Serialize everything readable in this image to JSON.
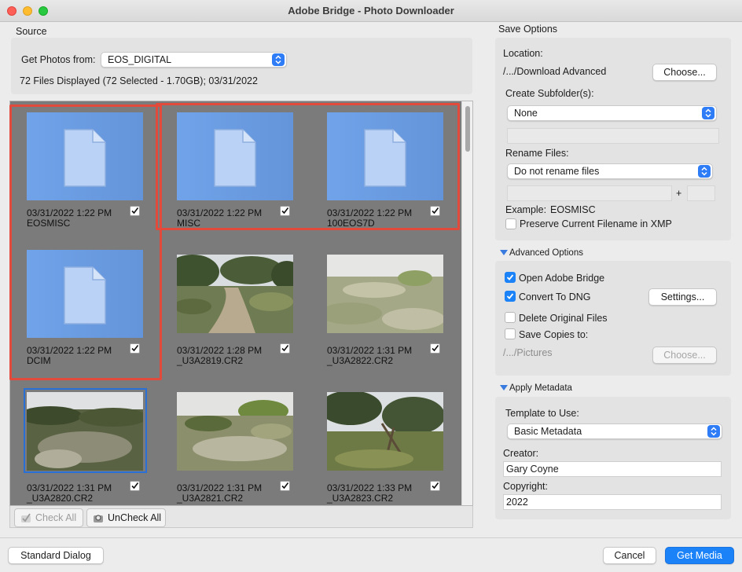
{
  "window": {
    "title": "Adobe Bridge - Photo Downloader"
  },
  "source": {
    "heading": "Source",
    "get_photos_label": "Get Photos from:",
    "device": "EOS_DIGITAL",
    "summary": "72 Files Displayed (72 Selected - 1.70GB); 03/31/2022"
  },
  "items": [
    {
      "date": "03/31/2022 1:22 PM",
      "name": "EOSMISC",
      "kind": "folder",
      "checked": true
    },
    {
      "date": "03/31/2022 1:22 PM",
      "name": "MISC",
      "kind": "folder",
      "checked": true
    },
    {
      "date": "03/31/2022 1:22 PM",
      "name": "100EOS7D",
      "kind": "folder",
      "checked": true
    },
    {
      "date": "03/31/2022 1:22 PM",
      "name": "DCIM",
      "kind": "folder",
      "checked": true
    },
    {
      "date": "03/31/2022 1:28 PM",
      "name": "_U3A2819.CR2",
      "kind": "photo",
      "checked": true
    },
    {
      "date": "03/31/2022 1:31 PM",
      "name": "_U3A2822.CR2",
      "kind": "photo",
      "checked": true
    },
    {
      "date": "03/31/2022 1:31 PM",
      "name": "_U3A2820.CR2",
      "kind": "photo",
      "checked": true
    },
    {
      "date": "03/31/2022 1:31 PM",
      "name": "_U3A2821.CR2",
      "kind": "photo",
      "checked": true
    },
    {
      "date": "03/31/2022 1:33 PM",
      "name": "_U3A2823.CR2",
      "kind": "photo",
      "checked": true
    }
  ],
  "grid_footer": {
    "check_all": "Check All",
    "uncheck_all": "UnCheck All"
  },
  "save_options": {
    "heading": "Save Options",
    "location_label": "Location:",
    "location_value": "/.../Download Advanced",
    "choose_button": "Choose...",
    "subfolder_label": "Create Subfolder(s):",
    "subfolder_value": "None",
    "rename_label": "Rename Files:",
    "rename_value": "Do not rename files",
    "plus": "+",
    "example_label": "Example:",
    "example_value": "EOSMISC",
    "preserve_label": "Preserve Current Filename in XMP"
  },
  "advanced": {
    "heading": "Advanced Options",
    "open_bridge": "Open Adobe Bridge",
    "convert_dng": "Convert To DNG",
    "settings_button": "Settings...",
    "delete_originals": "Delete Original Files",
    "save_copies": "Save Copies to:",
    "copies_path": "/.../Pictures",
    "choose_button": "Choose..."
  },
  "metadata": {
    "heading": "Apply Metadata",
    "template_label": "Template to Use:",
    "template_value": "Basic Metadata",
    "creator_label": "Creator:",
    "creator_value": "Gary Coyne",
    "copyright_label": "Copyright:",
    "copyright_value": "2022"
  },
  "footer": {
    "standard_dialog": "Standard Dialog",
    "cancel": "Cancel",
    "get_media": "Get Media"
  },
  "colors": {
    "accent": "#1b82f8",
    "annotation": "#e24a3b",
    "folder_thumb": "#6b9de3"
  }
}
